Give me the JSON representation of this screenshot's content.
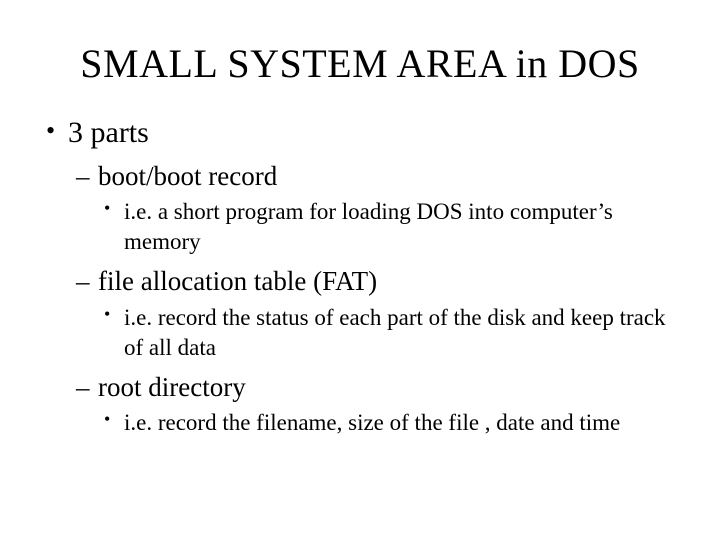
{
  "title": "SMALL SYSTEM AREA in DOS",
  "outline": {
    "heading": "3 parts",
    "items": [
      {
        "label": "boot/boot record",
        "detail": "i.e. a short program for loading DOS into computer’s memory"
      },
      {
        "label": "file allocation table (FAT)",
        "detail": "i.e. record the status of each part of the disk and keep track of all data"
      },
      {
        "label": "root directory",
        "detail": "i.e. record the filename, size of the file , date and time"
      }
    ]
  }
}
